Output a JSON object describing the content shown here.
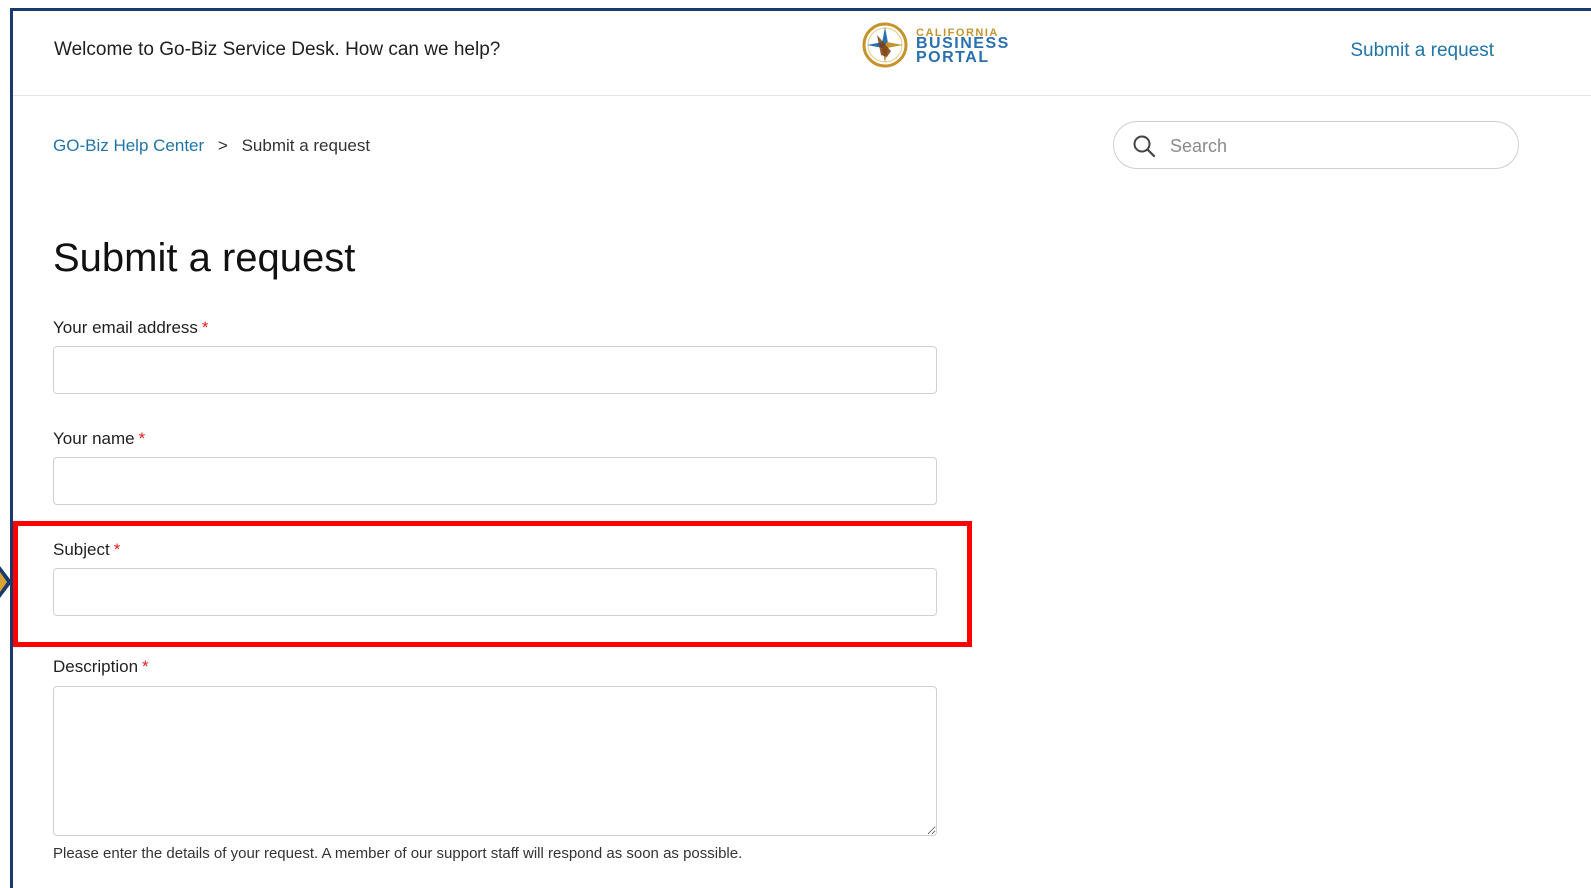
{
  "header": {
    "welcome": "Welcome to Go-Biz Service Desk. How can we help?",
    "logo": {
      "line1": "CALIFORNIA",
      "line2": "BUSINESS",
      "line3": "PORTAL",
      "icon": "compass-logo-icon"
    },
    "submit_link": "Submit a request"
  },
  "breadcrumb": {
    "home": "GO-Biz Help Center",
    "separator": ">",
    "current": "Submit a request"
  },
  "search": {
    "placeholder": "Search",
    "icon": "search-icon"
  },
  "form": {
    "title": "Submit a request",
    "required_marker": "*",
    "fields": {
      "email": {
        "label": "Your email address",
        "value": ""
      },
      "name": {
        "label": "Your name",
        "value": ""
      },
      "subject": {
        "label": "Subject",
        "value": ""
      },
      "description": {
        "label": "Description",
        "value": ""
      }
    },
    "description_help": "Please enter the details of your request. A member of our support staff will respond as soon as possible."
  },
  "colors": {
    "link": "#1f74a8",
    "required": "#e02020",
    "highlight": "#ff0000",
    "frame": "#1b3a6b",
    "logo_gold": "#c5942f",
    "logo_blue": "#2a6fae"
  }
}
